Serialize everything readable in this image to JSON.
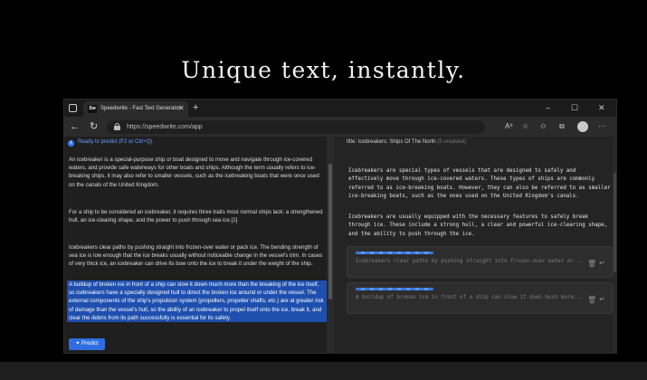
{
  "headline": "Unique text, instantly.",
  "browser": {
    "tab_favicon": "Sw",
    "tab_title": "Speedwrite - Fast Text Generator",
    "tab_close": "✕",
    "new_tab": "+",
    "url": "https://speedwrite.com/app",
    "window_controls": [
      "–",
      "☐",
      "✕"
    ],
    "nav": {
      "back": "←",
      "reload": "↻"
    },
    "tools": {
      "read_aloud": "A⁹",
      "favorite": "☆",
      "favorites_bar": "✩",
      "collections": "⧉",
      "more": "···"
    }
  },
  "editor": {
    "status_icon": "i",
    "status": "Ready to predict (F2 or Ctrl+Q)",
    "paragraphs": [
      "An icebreaker is a special-purpose ship or boat designed to move and navigate through ice-covered waters, and provide safe waterways for other boats and ships. Although the term usually refers to ice-breaking ships, it may also refer to smaller vessels, such as the icebreaking boats that were once used on the canals of the United Kingdom.",
      "For a ship to be considered an icebreaker, it requires three traits most normal ships lack: a strengthened hull, an ice-clearing shape, and the power to push through sea ice.[1]",
      "Icebreakers clear paths by pushing straight into frozen-over water or pack ice. The bending strength of sea ice is low enough that the ice breaks usually without noticeable change in the vessel's trim. In cases of very thick ice, an icebreaker can drive its bow onto the ice to break it under the weight of the ship."
    ],
    "selected_paragraph": "A buildup of broken ice in front of a ship can slow it down much more than the breaking of the ice itself, so icebreakers have a specially designed hull to direct the broken ice around or under the vessel. The external components of the ship's propulsion system (propellers, propeller shafts, etc.) are at greater risk of damage than the vessel's hull, so the ability of an icebreaker to propel itself onto the ice, break it, and clear the debris from its path successfully is essential for its safety.",
    "predict_button": "✦ Predict"
  },
  "output": {
    "title_label": "title:",
    "title": "Icebreakers: Ships Of The North",
    "unsaved": "(5 unsaved)",
    "paragraphs": [
      "Icebreakers are special types of vessels that are designed to safely and effectively move through ice-covered waters. These types of ships are commonly referred to as ice-breaking boats. However, they can also be referred to as smaller ice-breaking boats, such as the ones used on the United Kingdom's canals.",
      "Icebreakers are usually equipped with the necessary features to safely break through ice. These include a strong hull, a clear and powerful ice-clearing shape, and the ability to push through the ice."
    ],
    "suggestions": [
      {
        "text": "Icebreakers clear paths by pushing straight into frozen-over water or...",
        "trash": "🗑",
        "accept": "↵"
      },
      {
        "text": "A buildup of broken ice in front of a ship can slow it down much more...",
        "trash": "🗑",
        "accept": "↵"
      }
    ]
  }
}
